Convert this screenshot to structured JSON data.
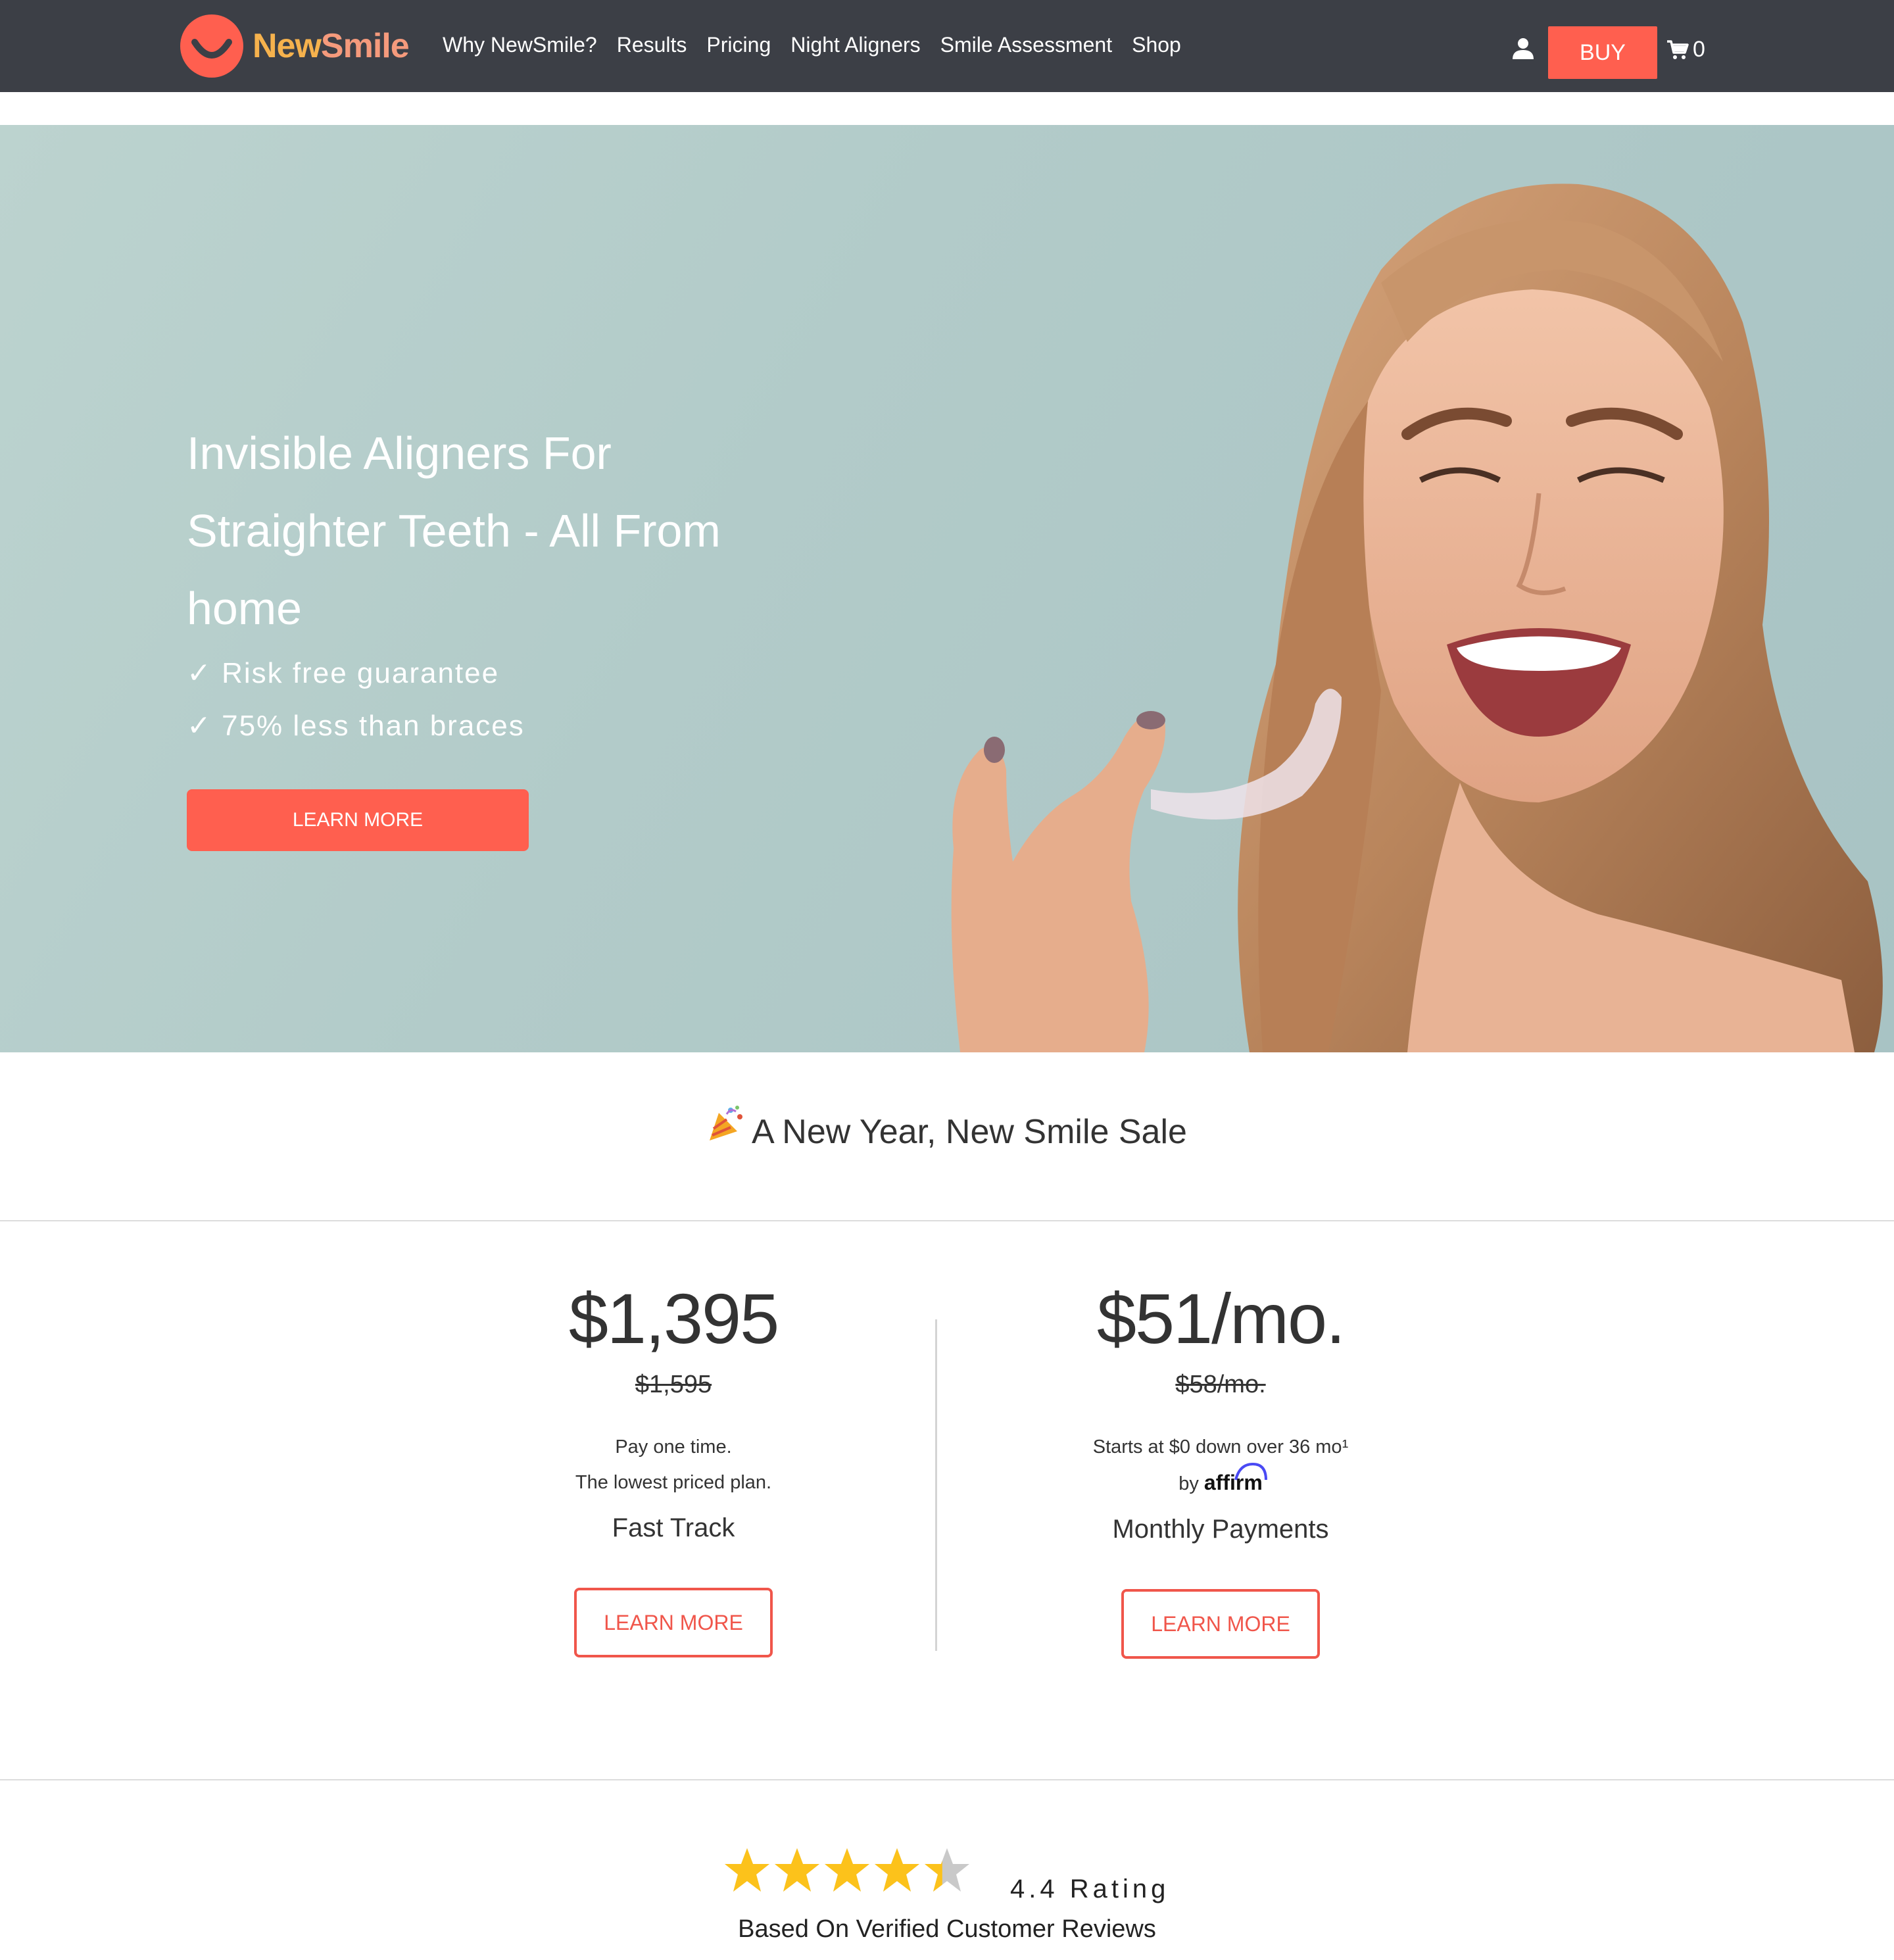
{
  "brand": {
    "name_part1": "New",
    "name_part2": "Smile",
    "logo_icon": "smile-logo-icon",
    "colors": {
      "accent": "#ff5f4f",
      "nav_bg": "#3c3f46",
      "logo_orange": "#f6b24d",
      "logo_pink": "#f59a7c"
    }
  },
  "nav": {
    "items": [
      {
        "label": "Why NewSmile?"
      },
      {
        "label": "Results"
      },
      {
        "label": "Pricing"
      },
      {
        "label": "Night Aligners"
      },
      {
        "label": "Smile Assessment"
      },
      {
        "label": "Shop"
      }
    ],
    "account_icon": "user-icon",
    "buy_label": "BUY",
    "cart_icon": "cart-icon",
    "cart_count": "0"
  },
  "hero": {
    "title": "Invisible Aligners For Straighter Teeth - All From home",
    "checks": [
      "✓ Risk free guarantee",
      "✓ 75% less than braces"
    ],
    "cta_label": "LEARN MORE",
    "image": "woman-holding-aligner-photo"
  },
  "sale": {
    "icon": "party-popper-icon",
    "heading": "A New Year, New Smile Sale"
  },
  "plans": [
    {
      "price": "$1,395",
      "old_price": "$1,595",
      "desc_line1": "Pay one time.",
      "desc_line2": "The lowest priced plan.",
      "name": "Fast Track",
      "cta_label": "LEARN MORE"
    },
    {
      "price": "$51/mo.",
      "old_price": "$58/mo.",
      "desc_line1": "Starts at $0 down over 36 mo¹",
      "desc_line2_prefix": "by",
      "desc_line2_brand": "affirm",
      "name": "Monthly Payments",
      "cta_label": "LEARN MORE"
    }
  ],
  "rating": {
    "value": 4.4,
    "max": 5,
    "label": "4.4 Rating",
    "sub": "Based On Verified Customer Reviews",
    "star_color": "#fcc21b"
  }
}
